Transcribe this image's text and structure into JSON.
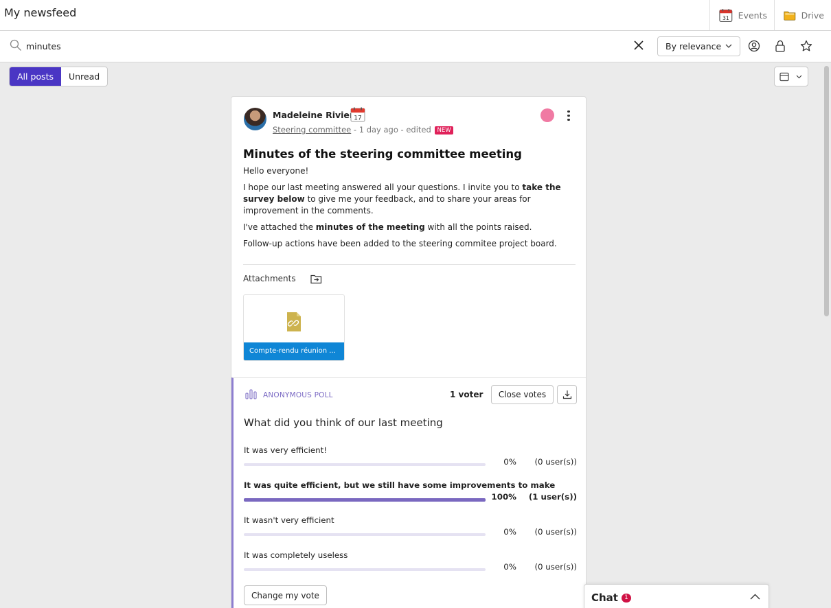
{
  "header": {
    "title": "My newsfeed",
    "apps": [
      {
        "label": "Events",
        "icon": "calendar-icon"
      },
      {
        "label": "Drive",
        "icon": "folder-icon"
      }
    ]
  },
  "search": {
    "value": "minutes",
    "sort": "By relevance"
  },
  "filters": {
    "all_posts": "All posts",
    "unread": "Unread",
    "active_color": "#4a36c4"
  },
  "post": {
    "author": "Madeleine Riviera",
    "calendar_day": "17",
    "community": "Steering committee",
    "time": "- 1 day ago",
    "edited": "- edited",
    "new_badge": "NEW",
    "title": "Minutes of the steering committee meeting",
    "body": {
      "p1": "Hello everyone!",
      "p2_a": "I hope our last meeting answered all your questions. I invite you to ",
      "p2_b": "take the survey below",
      "p2_c": " to give me your feedback, and to share your areas for improvement in the comments.",
      "p3_a": "I've attached the ",
      "p3_b": "minutes of the meeting",
      "p3_c": " with all the points raised.",
      "p4": "Follow-up actions have been added to the steering commitee project board."
    },
    "attachments_label": "Attachments",
    "attachment_name": "Compte-rendu réunion ..."
  },
  "poll": {
    "label": "ANONYMOUS POLL",
    "voters": "1 voter",
    "close_votes": "Close votes",
    "question": "What did you think of our last meeting",
    "options": [
      {
        "label": "It was very efficient!",
        "percent": "0%",
        "users": "(0 user(s))",
        "fraction": 0
      },
      {
        "label": "It was quite efficient, but we still have some improvements to make",
        "percent": "100%",
        "users": "(1 user(s))",
        "fraction": 1
      },
      {
        "label": "It wasn't very efficient",
        "percent": "0%",
        "users": "(0 user(s))",
        "fraction": 0
      },
      {
        "label": "It was completely useless",
        "percent": "0%",
        "users": "(0 user(s))",
        "fraction": 0
      }
    ],
    "change_vote": "Change my vote",
    "accent_color": "#7a68c0"
  },
  "chat": {
    "title": "Chat",
    "count": "1"
  }
}
